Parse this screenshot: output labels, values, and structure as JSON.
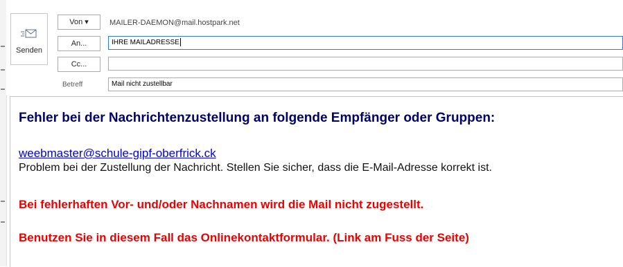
{
  "compose": {
    "send_label": "Senden",
    "from_button": "Von ▾",
    "from_value": "MAILER-DAEMON@mail.hostpark.net",
    "to_button": "An...",
    "to_value": "IHRE MAILADRESSE",
    "cc_button": "Cc...",
    "cc_value": "",
    "subject_label": "Betreff",
    "subject_value": "Mail nicht zustellbar"
  },
  "message": {
    "heading": "Fehler bei der Nachrichtenzustellung an folgende Empfänger oder Gruppen:",
    "recipient": "weebmaster@schule-gipf-oberfrick.ck",
    "problem": "Problem bei der Zustellung der Nachricht. Stellen Sie sicher, dass die E-Mail-Adresse korrekt ist.",
    "warning_1": "Bei fehlerhaften Vor- und/oder Nachnamen wird die Mail nicht zugestellt.",
    "warning_2": "Benutzen Sie in diesem Fall das Onlinekontaktformular. (Link am Fuss der Seite)"
  },
  "colors": {
    "heading": "#000066",
    "link": "#0000ee",
    "warning": "#ee0000",
    "focus_border": "#2b79d8"
  },
  "icons": {
    "send": "send-envelope-icon"
  }
}
